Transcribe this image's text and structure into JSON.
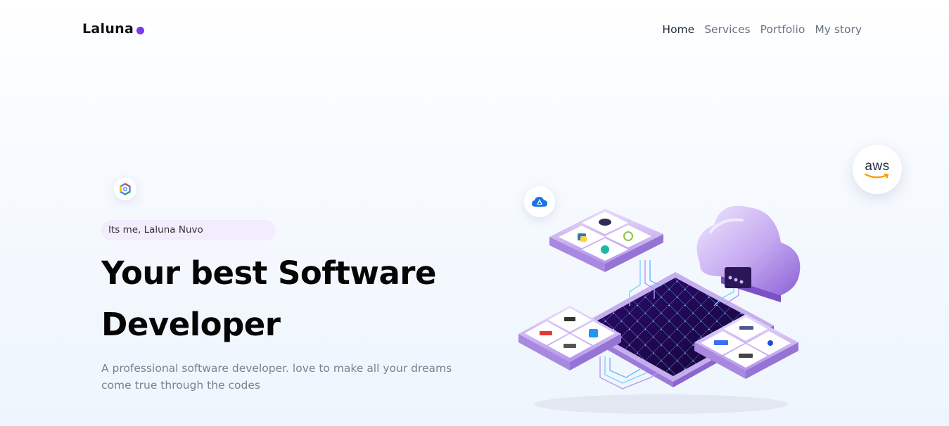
{
  "brand": {
    "name": "Laluna",
    "accent": "#7c3aed"
  },
  "nav": {
    "items": [
      {
        "label": "Home"
      },
      {
        "label": "Services"
      },
      {
        "label": "Portfolio"
      },
      {
        "label": "My story"
      }
    ]
  },
  "hero": {
    "tag": "Its me, Laluna Nuvo",
    "headline_line1": "Your best Software",
    "headline_line2": "Developer",
    "description": "A professional software developer. love to make all your dreams come true through the codes"
  },
  "badges": {
    "aws_label": "aws",
    "google_cloud_icon": "google-cloud-icon",
    "azure_icon": "azure-icon"
  },
  "illustration": {
    "icon": "cloud-platform-illustration"
  }
}
